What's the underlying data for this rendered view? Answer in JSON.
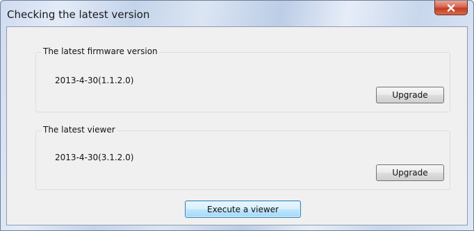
{
  "window": {
    "title": "Checking the latest version",
    "close_icon": "close-icon"
  },
  "firmware": {
    "legend": "The latest firmware version",
    "version": "2013-4-30(1.1.2.0)",
    "upgrade_label": "Upgrade"
  },
  "viewer": {
    "legend": "The latest viewer",
    "version": "2013-4-30(3.1.2.0)",
    "upgrade_label": "Upgrade"
  },
  "actions": {
    "execute_label": "Execute a viewer"
  },
  "colors": {
    "close_button": "#c8432b",
    "dialog_background": "#f0f0f0",
    "default_button_border": "#3c7fb1"
  }
}
